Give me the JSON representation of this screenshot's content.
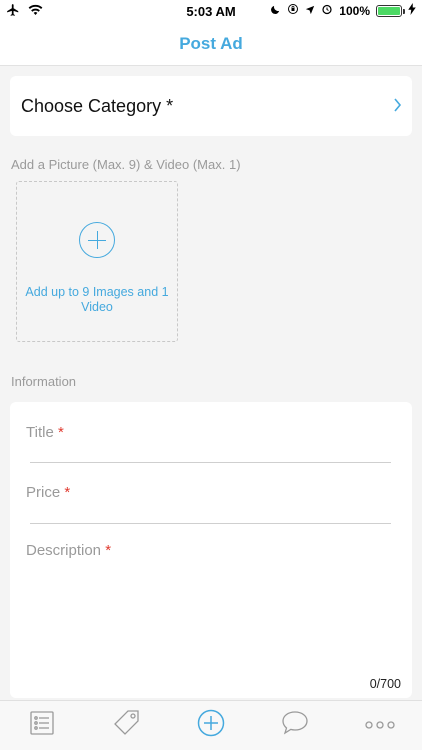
{
  "status_bar": {
    "time": "5:03 AM",
    "battery": "100%",
    "battery_level": 1.0,
    "icons": [
      "airplane-icon",
      "wifi-icon",
      "moon-icon",
      "rotation-lock-icon",
      "location-icon",
      "alarm-icon",
      "charging-icon"
    ]
  },
  "nav": {
    "title": "Post Ad"
  },
  "category": {
    "label": "Choose Category *"
  },
  "pictures": {
    "section_label": "Add a Picture (Max. 9) & Video (Max. 1)",
    "upload_text": "Add up to 9 Images and 1 Video"
  },
  "information": {
    "section_label": "Information",
    "title_placeholder": "Title",
    "price_placeholder": "Price",
    "description_placeholder": "Description",
    "required_mark": "*",
    "counter": "0/700"
  },
  "tabs": [
    {
      "name": "listings",
      "icon": "list-icon"
    },
    {
      "name": "tags",
      "icon": "tag-icon"
    },
    {
      "name": "post",
      "icon": "plus-circle-icon"
    },
    {
      "name": "messages",
      "icon": "chat-bubble-icon"
    },
    {
      "name": "more",
      "icon": "more-dots-icon"
    }
  ],
  "colors": {
    "accent": "#45a9de",
    "required": "#e03a2f",
    "background": "#f4f4f4"
  }
}
